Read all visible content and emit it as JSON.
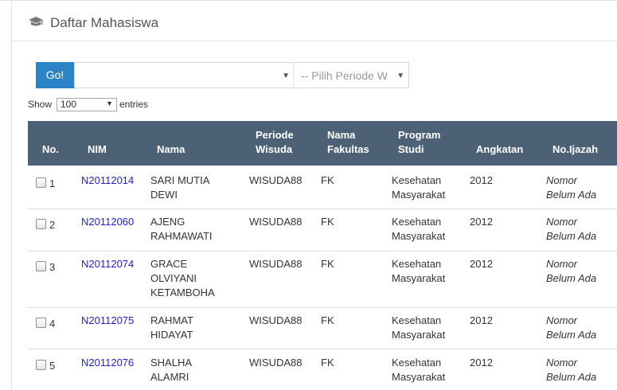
{
  "panel": {
    "title": "Daftar Mahasiswa",
    "icon": "graduation-cap-icon"
  },
  "filter": {
    "go_label": "Go!",
    "select1_value": "",
    "select2_value": "-- Pilih Periode Wisuda --"
  },
  "length": {
    "show_label": "Show",
    "value": "100",
    "entries_label": "entries"
  },
  "table": {
    "headers": {
      "no": "No.",
      "nim": "NIM",
      "nama": "Nama",
      "periode1": "Periode",
      "periode2": "Wisuda",
      "fakultas1": "Nama",
      "fakultas2": "Fakultas",
      "prodi1": "Program",
      "prodi2": "Studi",
      "angkatan": "Angkatan",
      "ijazah": "No.Ijazah"
    },
    "rows": [
      {
        "no": "1",
        "nim": "N20112014",
        "nama": [
          "SARI MUTIA",
          "DEWI"
        ],
        "periode": "WISUDA88",
        "fakultas": "FK",
        "prodi": [
          "Kesehatan",
          "Masyarakat"
        ],
        "angkatan": "2012",
        "ijazah": [
          "Nomor",
          "Belum Ada"
        ]
      },
      {
        "no": "2",
        "nim": "N20112060",
        "nama": [
          "AJENG",
          "RAHMAWATI"
        ],
        "periode": "WISUDA88",
        "fakultas": "FK",
        "prodi": [
          "Kesehatan",
          "Masyarakat"
        ],
        "angkatan": "2012",
        "ijazah": [
          "Nomor",
          "Belum Ada"
        ]
      },
      {
        "no": "3",
        "nim": "N20112074",
        "nama": [
          "GRACE",
          "OLVIYANI",
          "KETAMBOHA"
        ],
        "periode": "WISUDA88",
        "fakultas": "FK",
        "prodi": [
          "Kesehatan",
          "Masyarakat"
        ],
        "angkatan": "2012",
        "ijazah": [
          "Nomor",
          "Belum Ada"
        ]
      },
      {
        "no": "4",
        "nim": "N20112075",
        "nama": [
          "RAHMAT",
          "HIDAYAT"
        ],
        "periode": "WISUDA88",
        "fakultas": "FK",
        "prodi": [
          "Kesehatan",
          "Masyarakat"
        ],
        "angkatan": "2012",
        "ijazah": [
          "Nomor",
          "Belum Ada"
        ]
      },
      {
        "no": "5",
        "nim": "N20112076",
        "nama": [
          "SHALHA",
          "ALAMRI"
        ],
        "periode": "WISUDA88",
        "fakultas": "FK",
        "prodi": [
          "Kesehatan",
          "Masyarakat"
        ],
        "angkatan": "2012",
        "ijazah": [
          "Nomor",
          "Belum Ada"
        ]
      }
    ]
  },
  "colors": {
    "header_bg": "#4d6176",
    "go_button": "#2c83c6",
    "link": "#1f1fc4"
  }
}
